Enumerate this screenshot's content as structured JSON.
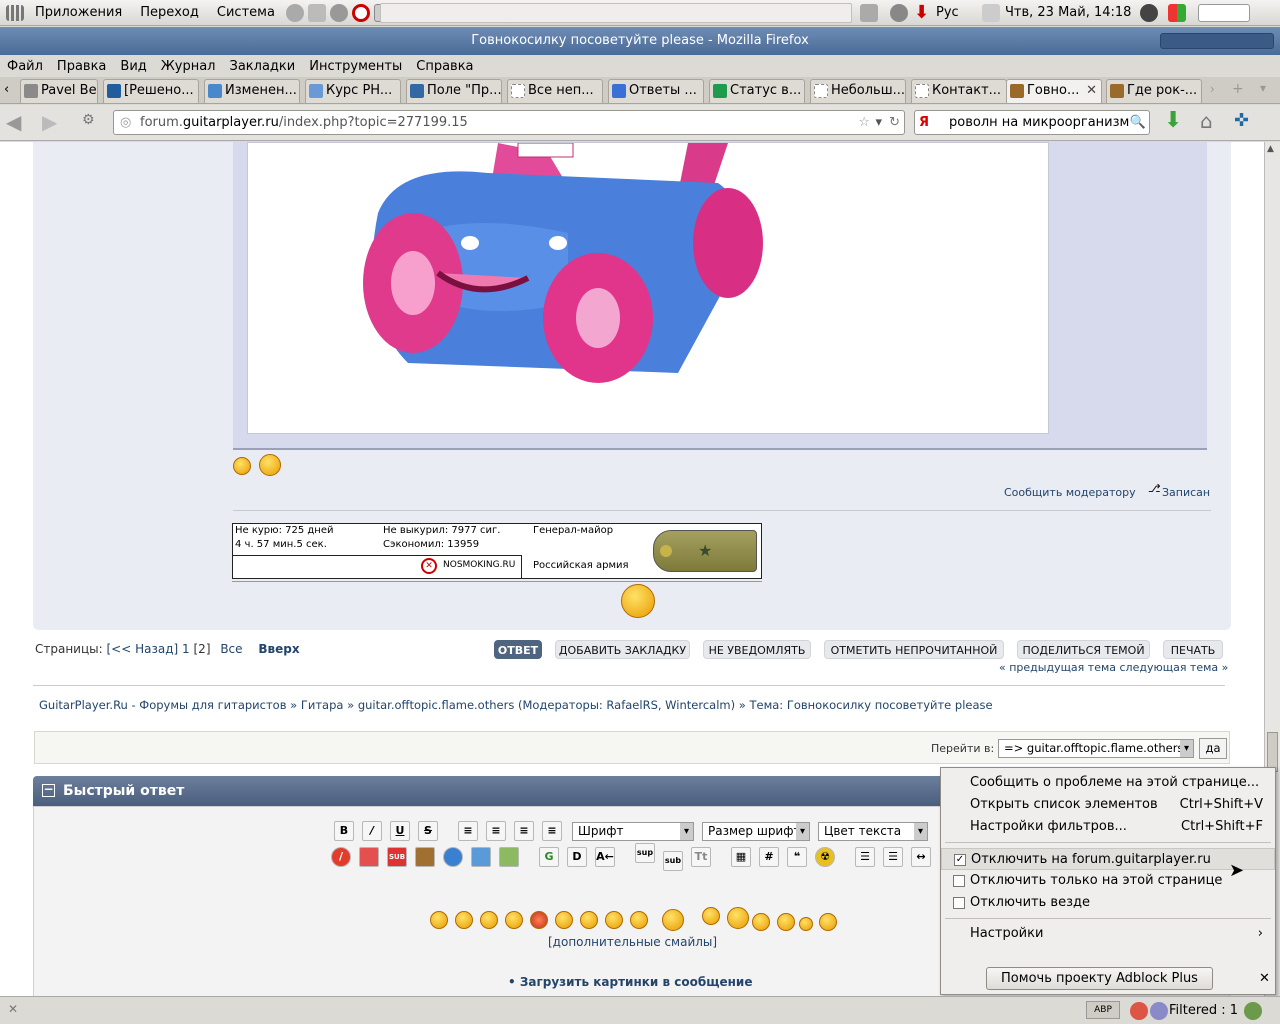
{
  "panel": {
    "apps": "Приложения",
    "places": "Переход",
    "system": "Система",
    "layout": "Рус",
    "datetime": "Чтв, 23 Май, 14:18"
  },
  "window": {
    "title": "Говнокосилку посоветуйте please - Mozilla Firefox"
  },
  "menubar": [
    "Файл",
    "Правка",
    "Вид",
    "Журнал",
    "Закладки",
    "Инструменты",
    "Справка"
  ],
  "tabs": [
    "Pavel Bel...",
    "[Решено...",
    "Изменен...",
    "Курс PH...",
    "Поле \"Пр...",
    "Все неп...",
    "Ответы ...",
    "Статус в...",
    "Небольш...",
    "Контакт...",
    "Говно...",
    "Где рок-..."
  ],
  "nav": {
    "url_host": "forum.guitarplayer.ru",
    "url_path": "/index.php?topic=277199.15",
    "url_prefix": "forum.",
    "url_domain": "guitarplayer.ru",
    "search_value": "роволн на микроорганизмы",
    "search_engine": "Я"
  },
  "post": {
    "report": "Сообщить модератору",
    "logged": "Записан"
  },
  "signature": {
    "no_smoke": "Не курю: 725 дней",
    "time": "4 ч. 57 мин.5 сек.",
    "not_smoked": "Не выкурил: 7977 сиг.",
    "saved": "Сэкономил: 13959",
    "rank": "Генерал-майор",
    "army": "Российская армия",
    "site": "NOSMOKING.RU"
  },
  "pagination": {
    "label": "Страницы:",
    "back": "[<< Назад]",
    "p1": "1",
    "p2": "[2]",
    "all": "Все",
    "top": "Вверх"
  },
  "buttons": [
    "ОТВЕТ",
    "ДОБАВИТЬ ЗАКЛАДКУ",
    "НЕ УВЕДОМЛЯТЬ",
    "ОТМЕТИТЬ НЕПРОЧИТАННОЙ",
    "ПОДЕЛИТЬСЯ ТЕМОЙ",
    "ПЕЧАТЬ"
  ],
  "topic_nav": "« предыдущая тема следующая тема »",
  "breadcrumb": {
    "site": "GuitarPlayer.Ru - Форумы для гитаристов",
    "sep": "»",
    "cat": "Гитара",
    "board": "guitar.offtopic.flame.others",
    "mods": "(Модераторы: RafaelRS, Wintercalm)",
    "topic": "Тема: Говнокосилку посоветуйте please"
  },
  "jump": {
    "label": "Перейти в:",
    "value": "=> guitar.offtopic.flame.others",
    "go": "да"
  },
  "quick": {
    "title": "Быстрый ответ",
    "font": "Шрифт",
    "size": "Размер шрифта",
    "color": "Цвет текста",
    "more_smileys": "[дополнительные смайлы]",
    "upload": "• Загрузить картинки в сообщение"
  },
  "popup": {
    "report": "Сообщить о проблеме на этой странице...",
    "list": "Открыть список элементов",
    "list_sc": "Ctrl+Shift+V",
    "filters": "Настройки фильтров...",
    "filters_sc": "Ctrl+Shift+F",
    "disable_site": "Отключить на forum.guitarplayer.ru",
    "disable_page": "Отключить только на этой странице",
    "disable_all": "Отключить везде",
    "settings": "Настройки",
    "help": "Помочь проекту Adblock Plus"
  },
  "status": {
    "filtered": "Filtered : 1",
    "abp": "ABP"
  }
}
